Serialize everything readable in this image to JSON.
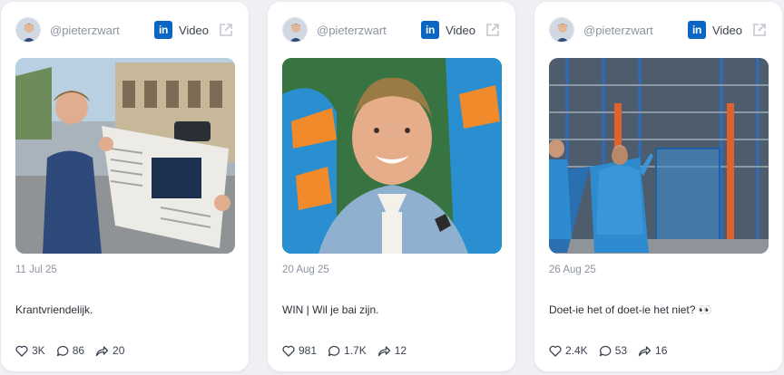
{
  "accent_color": "#0a66c2",
  "cards": [
    {
      "handle": "@pieterzwart",
      "network_icon": "linkedin-icon",
      "media_type": "Video",
      "date": "11 Jul 25",
      "caption": "Krantvriendelijk.",
      "likes": "3K",
      "comments": "86",
      "shares": "20"
    },
    {
      "handle": "@pieterzwart",
      "network_icon": "linkedin-icon",
      "media_type": "Video",
      "date": "20 Aug 25",
      "caption": "WIN | Wil je bai zijn.",
      "likes": "981",
      "comments": "1.7K",
      "shares": "12"
    },
    {
      "handle": "@pieterzwart",
      "network_icon": "linkedin-icon",
      "media_type": "Video",
      "date": "26 Aug 25",
      "caption": "Doet-ie het of doet-ie het niet? 👀",
      "likes": "2.4K",
      "comments": "53",
      "shares": "16"
    }
  ],
  "linkedin_logo_text": "in"
}
